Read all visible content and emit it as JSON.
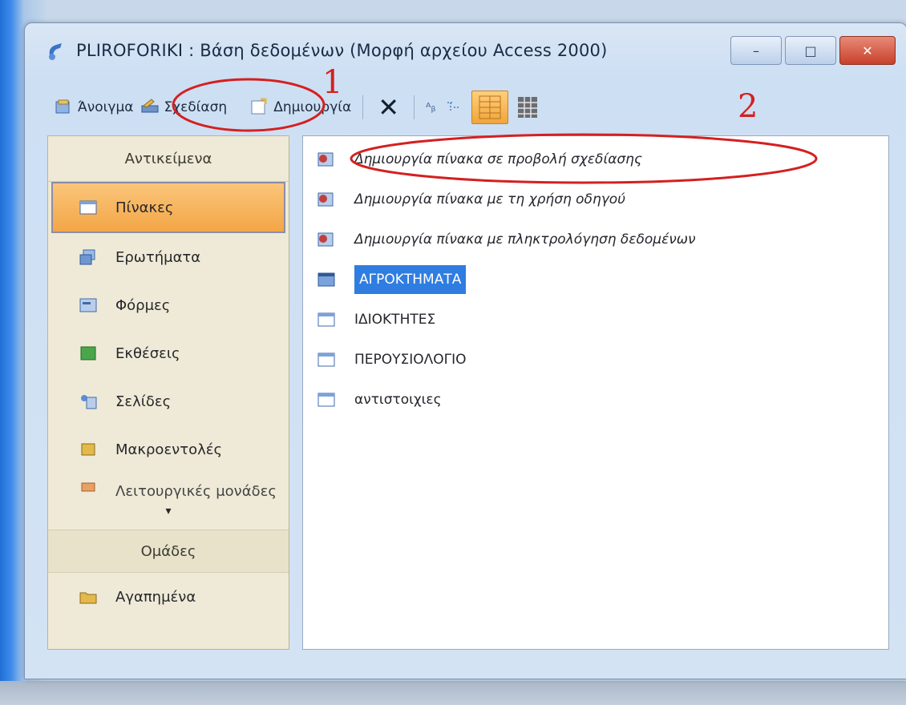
{
  "window": {
    "title": "PLIROFORIKI : Βάση δεδομένων (Μορφή αρχείου Access 2000)",
    "controls": {
      "minimize": "–",
      "maximize": "□",
      "close": "✕"
    }
  },
  "toolbar": {
    "open_label": "Άνοιγμα",
    "design_label": "Σχεδίαση",
    "new_label": "Δημιουργία",
    "delete_symbol": "✕",
    "small_icons": "ᴬᵦ"
  },
  "sidebar": {
    "header": "Αντικείμενα",
    "items": [
      {
        "label": "Πίνακες",
        "icon": "table-icon",
        "selected": true
      },
      {
        "label": "Ερωτήματα",
        "icon": "query-icon"
      },
      {
        "label": "Φόρμες",
        "icon": "form-icon"
      },
      {
        "label": "Εκθέσεις",
        "icon": "report-icon"
      },
      {
        "label": "Σελίδες",
        "icon": "page-icon"
      },
      {
        "label": "Μακροεντολές",
        "icon": "macro-icon"
      },
      {
        "label": "Λειτουργικές μονάδες",
        "icon": "module-icon"
      }
    ],
    "more_arrow": "▾",
    "groups_header": "Ομάδες",
    "favorites": "Αγαπημένα"
  },
  "objects": {
    "wizards": [
      "Δημιουργία πίνακα σε προβολή σχεδίασης",
      "Δημιουργία πίνακα με τη χρήση οδηγού",
      "Δημιουργία πίνακα με πληκτρολόγηση δεδομένων"
    ],
    "tables": [
      {
        "name": "ΑΓΡΟΚΤΗΜΑΤΑ",
        "selected": true
      },
      {
        "name": "ΙΔΙΟΚΤΗΤΕΣ"
      },
      {
        "name": "ΠΕΡΟΥΣΙΟΛΟΓΙΟ"
      },
      {
        "name": "αντιστοιχιες"
      }
    ]
  },
  "annotations": {
    "number_1": "1",
    "number_2": "2",
    "color": "#d42020"
  },
  "colors": {
    "selected_item": "#f3a646",
    "selected_table": "#2f7de1",
    "close_button": "#c8412a"
  }
}
